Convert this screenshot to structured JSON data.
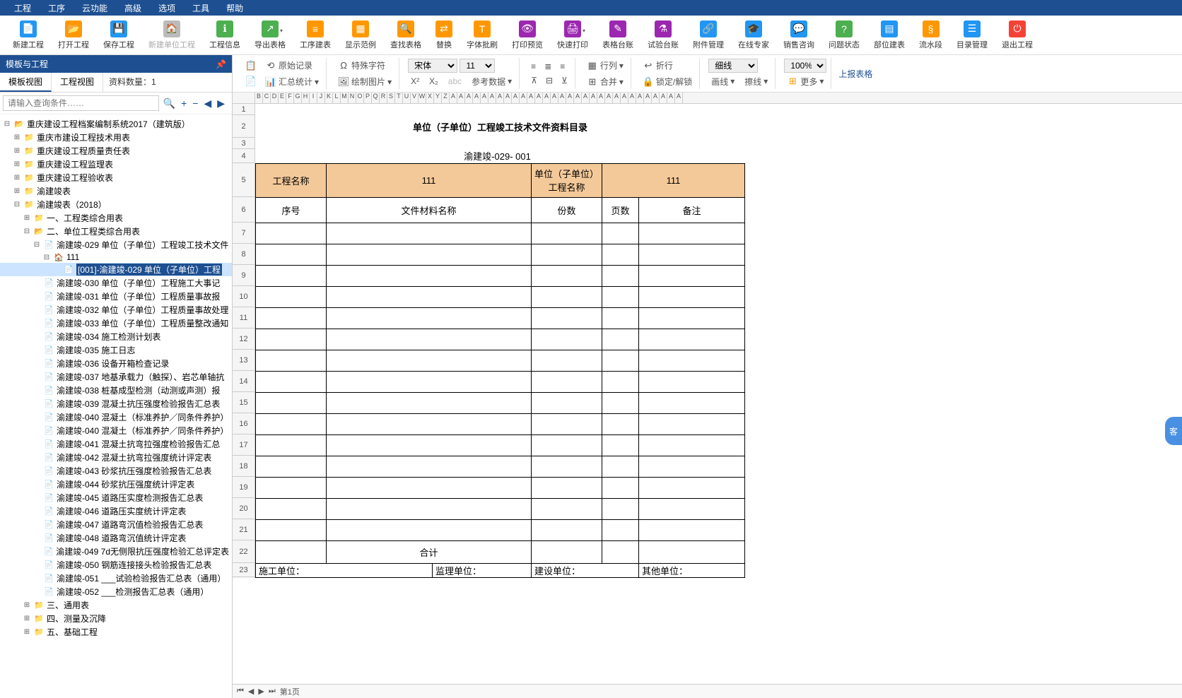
{
  "menu": [
    "工程",
    "工序",
    "云功能",
    "高级",
    "选项",
    "工具",
    "帮助"
  ],
  "toolbar": [
    {
      "label": "新建工程",
      "color": "#2196f3",
      "glyph": "📄"
    },
    {
      "label": "打开工程",
      "color": "#ff9800",
      "glyph": "📂"
    },
    {
      "label": "保存工程",
      "color": "#2196f3",
      "glyph": "💾"
    },
    {
      "label": "新建单位工程",
      "color": "#bbb",
      "glyph": "🏠",
      "disabled": true
    },
    {
      "label": "工程信息",
      "color": "#4caf50",
      "glyph": "ℹ"
    },
    {
      "label": "导出表格",
      "color": "#4caf50",
      "glyph": "↗",
      "dropdown": true
    },
    {
      "label": "工序建表",
      "color": "#ff9800",
      "glyph": "≡"
    },
    {
      "label": "显示范例",
      "color": "#ff9800",
      "glyph": "▦"
    },
    {
      "label": "查找表格",
      "color": "#ff9800",
      "glyph": "🔍"
    },
    {
      "label": "替换",
      "color": "#ff9800",
      "glyph": "⇄"
    },
    {
      "label": "字体批刷",
      "color": "#ff9800",
      "glyph": "T"
    },
    {
      "label": "打印预览",
      "color": "#9c27b0",
      "glyph": "👁"
    },
    {
      "label": "快速打印",
      "color": "#9c27b0",
      "glyph": "🖨",
      "dropdown": true
    },
    {
      "label": "表格台账",
      "color": "#9c27b0",
      "glyph": "✎"
    },
    {
      "label": "试验台账",
      "color": "#9c27b0",
      "glyph": "⚗"
    },
    {
      "label": "附件管理",
      "color": "#2196f3",
      "glyph": "🔗"
    },
    {
      "label": "在线专家",
      "color": "#2196f3",
      "glyph": "🎓"
    },
    {
      "label": "销售咨询",
      "color": "#2196f3",
      "glyph": "💬"
    },
    {
      "label": "问题状态",
      "color": "#4caf50",
      "glyph": "?"
    },
    {
      "label": "部位建表",
      "color": "#2196f3",
      "glyph": "▤"
    },
    {
      "label": "流水段",
      "color": "#ff9800",
      "glyph": "§"
    },
    {
      "label": "目录管理",
      "color": "#2196f3",
      "glyph": "☰"
    },
    {
      "label": "退出工程",
      "color": "#f44336",
      "glyph": "⏻"
    }
  ],
  "sidebar": {
    "title": "模板与工程",
    "tabs": [
      "模板视图",
      "工程视图"
    ],
    "count_label": "资料数量：",
    "count_value": "1",
    "search_placeholder": "请输入查询条件……"
  },
  "tree": {
    "root": "重庆建设工程档案编制系统2017（建筑版）",
    "l1": [
      "重庆市建设工程技术用表",
      "重庆建设工程质量责任表",
      "重庆建设工程监理表",
      "重庆建设工程验收表",
      "渝建竣表",
      "渝建竣表（2018）"
    ],
    "l2": [
      "一、工程类综合用表",
      "二、单位工程类综合用表"
    ],
    "doc029": "渝建竣-029 单位（子单位）工程竣工技术文件",
    "node111": "111",
    "selected": "[001]-渝建竣-029 单位（子单位）工程",
    "docs": [
      "渝建竣-030 单位（子单位）工程施工大事记",
      "渝建竣-031 单位（子单位）工程质量事故报",
      "渝建竣-032 单位（子单位）工程质量事故处理",
      "渝建竣-033 单位（子单位）工程质量整改通知",
      "渝建竣-034 施工检测计划表",
      "渝建竣-035 施工日志",
      "渝建竣-036 设备开箱检查记录",
      "渝建竣-037 地基承载力（触探）、岩芯单轴抗",
      "渝建竣-038 桩基成型检测（动测或声测）报",
      "渝建竣-039 混凝土抗压强度检验报告汇总表",
      "渝建竣-040 混凝土（标准养护／同条件养护）",
      "渝建竣-040 混凝土（标准养护／同条件养护）",
      "渝建竣-041 混凝土抗弯拉强度检验报告汇总",
      "渝建竣-042 混凝土抗弯拉强度统计评定表",
      "渝建竣-043 砂浆抗压强度检验报告汇总表",
      "渝建竣-044 砂浆抗压强度统计评定表",
      "渝建竣-045 道路压实度检测报告汇总表",
      "渝建竣-046 道路压实度统计评定表",
      "渝建竣-047 道路弯沉值检验报告汇总表",
      "渝建竣-048 道路弯沉值统计评定表",
      "渝建竣-049 7d无侧限抗压强度检验汇总评定表",
      "渝建竣-050 钢筋连接接头检验报告汇总表",
      "渝建竣-051 ___试验检验报告汇总表（通用）",
      "渝建竣-052 ___检测报告汇总表（通用）"
    ],
    "l2_more": [
      "三、通用表",
      "四、测量及沉降",
      "五、基础工程"
    ]
  },
  "ribbon": {
    "original": "原始记录",
    "stats": "汇总统计",
    "special": "特殊字符",
    "drawpic": "绘制图片",
    "ref": "参考数据",
    "font": "宋体",
    "size": "11",
    "row": "行列",
    "merge": "合并",
    "wrap": "折行",
    "lock": "锁定/解锁",
    "line_style": "细线",
    "line": "画线",
    "erase": "擦线",
    "zoom": "100%",
    "more": "更多",
    "upload": "上报表格"
  },
  "doc": {
    "title": "单位（子单位）工程竣工技术文件资料目录",
    "code": "渝建竣-029- 001",
    "proj_name_label": "工程名称",
    "proj_name": "111",
    "unit_name_label": "单位（子单位）工程名称",
    "unit_name": "111",
    "col1": "序号",
    "col2": "文件材料名称",
    "col3": "份数",
    "col4": "页数",
    "col5": "备注",
    "total": "合计",
    "f1": "施工单位：",
    "f2": "监理单位：",
    "f3": "建设单位：",
    "f4": "其他单位："
  },
  "pager": {
    "page": "第1页"
  },
  "float": "客"
}
